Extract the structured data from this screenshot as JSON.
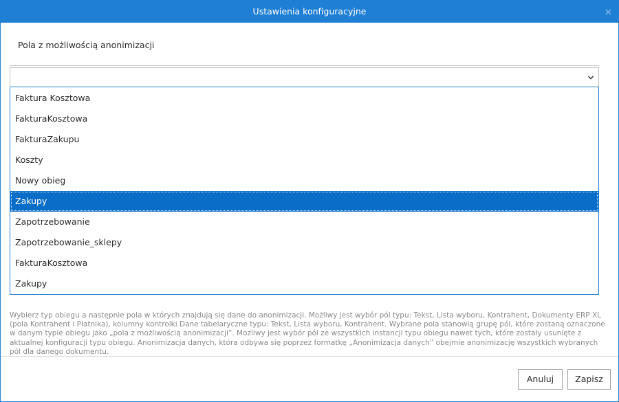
{
  "window": {
    "title": "Ustawienia konfiguracyjne",
    "accent_color": "#1f7fd4",
    "selection_color": "#0a6ec8",
    "close_icon": "close-icon"
  },
  "section": {
    "label": "Pola z możliwością anonimizacji"
  },
  "combo": {
    "value": "",
    "arrow_icon": "chevron-down-icon"
  },
  "dropdown": {
    "items": [
      {
        "label": "Faktura Kosztowa",
        "selected": false
      },
      {
        "label": "FakturaKosztowa",
        "selected": false
      },
      {
        "label": "FakturaZakupu",
        "selected": false
      },
      {
        "label": "Koszty",
        "selected": false
      },
      {
        "label": "Nowy obieg",
        "selected": false
      },
      {
        "label": "Zakupy",
        "selected": true
      },
      {
        "label": "Zapotrzebowanie",
        "selected": false
      },
      {
        "label": "Zapotrzebowanie_sklepy",
        "selected": false
      },
      {
        "label": "FakturaKosztowa",
        "selected": false
      },
      {
        "label": "Zakupy",
        "selected": false
      }
    ]
  },
  "help": {
    "text": "Wybierz typ obiegu a następnie pola w których znajdują się dane do anonimizacji. Możliwy jest wybór pól typu: Tekst, Lista wyboru, Kontrahent, Dokumenty ERP XL (pola Kontrahent i Płatnika), kolumny kontrolki Dane tabelaryczne typu: Tekst, Lista wyboru, Kontrahent. Wybrane pola stanowią grupę pól, które zostaną oznaczone w danym typie obiegu jako „pola z możliwością anonimizacji”. Możliwy jest wybór pól ze wszystkich instancji typu obiegu nawet tych, które zostały usunięte z aktualnej konfiguracji typu obiegu. Anonimizacja danych, która odbywa się poprzez formatkę „Anonimizacja danych” obejmie anonimizację wszystkich wybranych pól dla danego dokumentu."
  },
  "buttons": {
    "cancel": "Anuluj",
    "save": "Zapisz"
  }
}
